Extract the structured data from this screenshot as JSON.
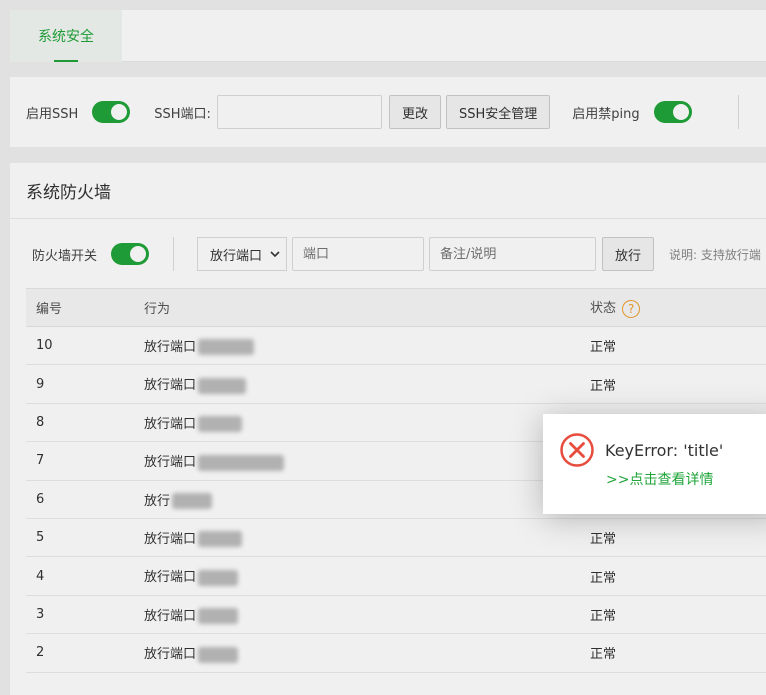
{
  "tabs": [
    {
      "label": "系统安全",
      "active": true
    }
  ],
  "ssh": {
    "enable_label": "启用SSH",
    "enable_on": true,
    "port_label": "SSH端口:",
    "port_value": "",
    "change_button": "更改",
    "manage_button": "SSH安全管理",
    "ping_label": "启用禁ping",
    "ping_on": true
  },
  "firewall": {
    "title": "系统防火墙",
    "switch_label": "防火墙开关",
    "switch_on": true,
    "type_select": "放行端口",
    "port_placeholder": "端口",
    "note_placeholder": "备注/说明",
    "allow_button": "放行",
    "hint": "说明: 支持放行端",
    "columns": [
      "编号",
      "行为",
      "状态"
    ],
    "rows": [
      {
        "id": "10",
        "action": "放行端口",
        "status": "正常"
      },
      {
        "id": "9",
        "action": "放行端口",
        "status": "正常"
      },
      {
        "id": "8",
        "action": "放行端口",
        "status": ""
      },
      {
        "id": "7",
        "action": "放行端口",
        "status": ""
      },
      {
        "id": "6",
        "action": "放行",
        "status": ""
      },
      {
        "id": "5",
        "action": "放行端口",
        "status": "正常"
      },
      {
        "id": "4",
        "action": "放行端口",
        "status": "正常"
      },
      {
        "id": "3",
        "action": "放行端口",
        "status": "正常"
      },
      {
        "id": "2",
        "action": "放行端口",
        "status": "正常"
      }
    ]
  },
  "toast": {
    "message": "KeyError: 'title'",
    "link": ">>点击查看详情"
  },
  "colors": {
    "accent": "#20a53a",
    "error": "#e74c3c",
    "help": "#f0a030"
  }
}
